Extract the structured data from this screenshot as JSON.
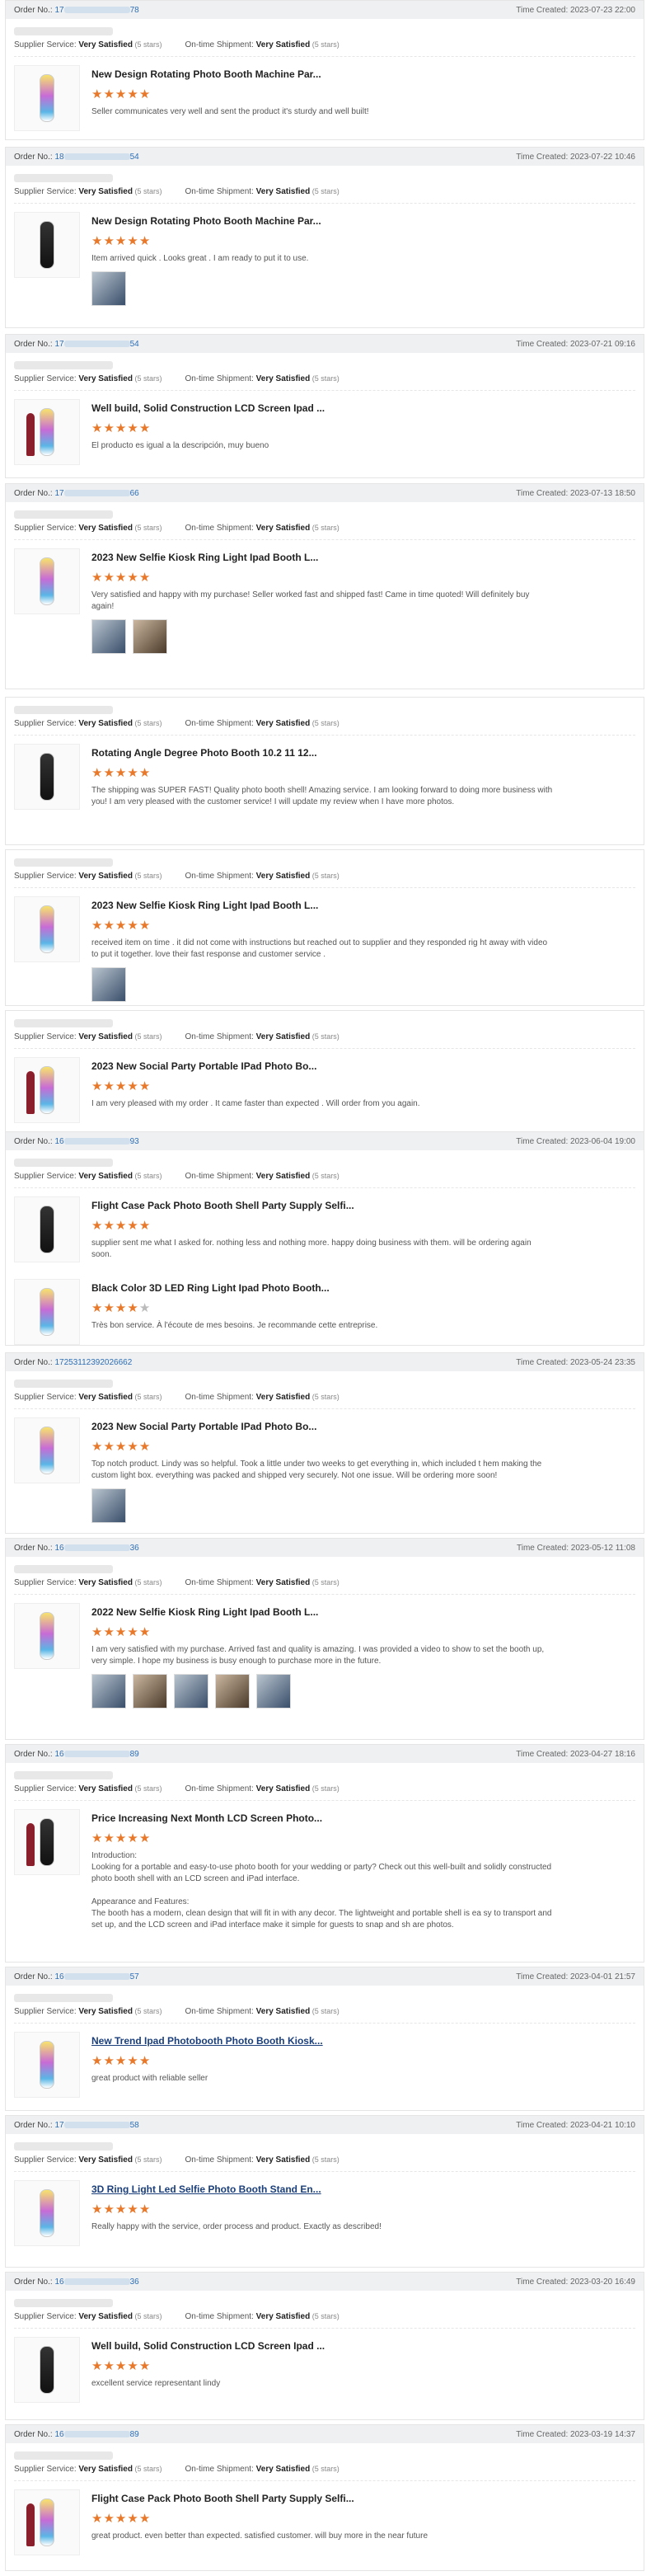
{
  "labels": {
    "order_no": "Order No.:",
    "time_created": "Time Created:",
    "supplier_service": "Supplier Service:",
    "on_time": "On-time Shipment:",
    "very_satisfied": "Very Satisfied",
    "five_stars": "(5 stars)"
  },
  "orders": [
    {
      "no_prefix": "17",
      "no_suffix": "78",
      "time": "2023-07-23 22:00",
      "product": "New Design Rotating Photo Booth Machine Par...",
      "rating": 5,
      "comment": "Seller communicates very well and sent the product it's sturdy and well built!",
      "photos": 0
    },
    {
      "no_prefix": "18",
      "no_suffix": "54",
      "time": "2023-07-22 10:46",
      "product": "New Design Rotating Photo Booth Machine Par...",
      "rating": 5,
      "comment": "Item arrived quick . Looks great . I am ready to put it to use.",
      "photos": 1
    },
    {
      "no_prefix": "17",
      "no_suffix": "54",
      "time": "2023-07-21 09:16",
      "product": "Well build, Solid Construction LCD Screen Ipad ...",
      "rating": 5,
      "comment": "El producto es igual a la descripción, muy bueno",
      "photos": 0
    },
    {
      "no_prefix": "17",
      "no_suffix": "66",
      "time": "2023-07-13 18:50",
      "product": "2023 New Selfie Kiosk Ring Light Ipad Booth L...",
      "rating": 5,
      "comment": "Very satisfied and happy with my purchase! Seller worked fast and shipped fast! Came in time quoted! Will definitely buy again!",
      "photos": 2
    },
    {
      "no_prefix": "",
      "no_suffix": "",
      "time": "",
      "product": "Rotating Angle Degree Photo Booth 10.2 11 12...",
      "rating": 5,
      "comment": "The shipping was SUPER FAST! Quality photo booth shell! Amazing service. I am looking forward to doing more business with you! I am very pleased with the customer service! I will update my review when I have more photos.",
      "photos": 0
    },
    {
      "no_prefix": "",
      "no_suffix": "",
      "time": "",
      "product": "2023 New Selfie Kiosk Ring Light Ipad Booth L...",
      "rating": 5,
      "comment": "received item on time . it did not come with instructions but reached out to supplier and they responded rig ht away with video to put it together. love their fast response and customer service .",
      "photos": 1
    },
    {
      "no_prefix": "",
      "no_suffix": "",
      "time": "",
      "product": "2023 New Social Party Portable IPad Photo Bo...",
      "rating": 5,
      "comment": "I am very pleased with my order . It came faster than expected . Will order from you again.",
      "photos": 0
    },
    {
      "no_prefix": "16",
      "no_suffix": "93",
      "time": "2023-06-04 19:00",
      "product": "Flight Case Pack Photo Booth Shell Party Supply Selfi...",
      "rating": 5,
      "comment": "supplier sent me what I asked for. nothing less and nothing more. happy doing business with them. will be ordering again soon.",
      "photos": 0,
      "extra_product": "Black Color 3D LED Ring Light Ipad Photo Booth...",
      "extra_rating": 4,
      "extra_comment": "Très bon service. À l'écoute de mes besoins. Je recommande cette entreprise."
    },
    {
      "no_prefix": "17253112392026662",
      "no_suffix": "",
      "time": "2023-05-24 23:35",
      "product": "2023 New Social Party Portable IPad Photo Bo...",
      "rating": 5,
      "comment": "Top notch product. Lindy was so helpful. Took a little under two weeks to get everything in, which included t hem making the custom light box. everything was packed and shipped very securely. Not one issue. Will be ordering more soon!",
      "photos": 1
    },
    {
      "no_prefix": "16",
      "no_suffix": "36",
      "time": "2023-05-12 11:08",
      "product": "2022 New Selfie Kiosk Ring Light Ipad Booth L...",
      "rating": 5,
      "comment": "I am very satisfied with my purchase. Arrived fast and quality is amazing. I was provided a video to show to set the booth up, very simple. I hope my business is busy enough to purchase more in the future.",
      "photos": 5
    },
    {
      "no_prefix": "16",
      "no_suffix": "89",
      "time": "2023-04-27 18:16",
      "product": "Price Increasing Next Month LCD Screen Photo...",
      "rating": 5,
      "comment": "Introduction:\nLooking for a portable and easy-to-use photo booth for your wedding or party? Check out this well-built and solidly constructed photo booth shell with an LCD screen and iPad interface.\n\nAppearance and Features:\nThe booth has a modern, clean design that will fit in with any decor. The lightweight and portable shell is ea sy to transport and set up, and the LCD screen and iPad interface make it simple for guests to snap and sh are photos.",
      "photos": 0
    },
    {
      "no_prefix": "16",
      "no_suffix": "57",
      "time": "2023-04-01 21:57",
      "product": "New Trend Ipad Photobooth Photo Booth Kiosk...",
      "rating": 5,
      "comment": "great product with reliable seller",
      "photos": 0
    },
    {
      "no_prefix": "17",
      "no_suffix": "58",
      "time": "2023-04-21 10:10",
      "product": "3D Ring Light Led Selfie Photo Booth Stand En...",
      "rating": 5,
      "comment": "Really happy with the service, order process and product. Exactly as described!",
      "photos": 0
    },
    {
      "no_prefix": "16",
      "no_suffix": "36",
      "time": "2023-03-20 16:49",
      "product": "Well build, Solid Construction LCD Screen Ipad ...",
      "rating": 5,
      "comment": "excellent service representant lindy",
      "photos": 0
    },
    {
      "no_prefix": "16",
      "no_suffix": "89",
      "time": "2023-03-19 14:37",
      "product": "Flight Case Pack Photo Booth Shell Party Supply Selfi...",
      "rating": 5,
      "comment": "great product. even better than expected. satisfied customer. will buy more in the near future",
      "photos": 0
    }
  ]
}
